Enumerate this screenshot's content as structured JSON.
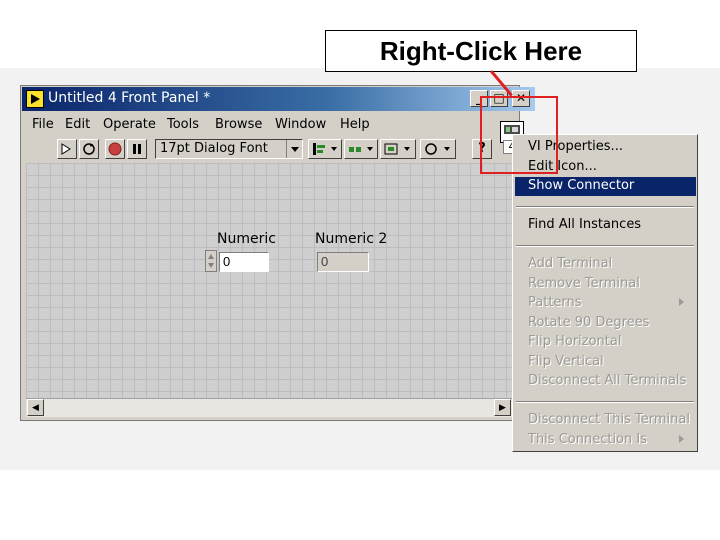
{
  "callout": {
    "text": "Right-Click Here"
  },
  "window": {
    "title": "Untitled 4 Front Panel *",
    "controls": {
      "minimize": "_",
      "maximize": "□",
      "close": "✕"
    }
  },
  "menubar": {
    "items": [
      {
        "label": "File"
      },
      {
        "label": "Edit"
      },
      {
        "label": "Operate"
      },
      {
        "label": "Tools"
      },
      {
        "label": "Browse"
      },
      {
        "label": "Window"
      },
      {
        "label": "Help"
      }
    ]
  },
  "toolbar": {
    "font_selector": "17pt Dialog Font",
    "help_icon": "?",
    "connector_badge": "4"
  },
  "panel": {
    "numeric1": {
      "label": "Numeric",
      "value": "0"
    },
    "numeric2": {
      "label": "Numeric 2",
      "value": "0"
    }
  },
  "context_menu": {
    "items": [
      {
        "label": "VI Properties...",
        "enabled": true
      },
      {
        "label": "Edit Icon...",
        "enabled": true
      },
      {
        "label": "Show Connector",
        "enabled": true,
        "selected": true
      },
      {
        "label": "Find All Instances",
        "enabled": true
      },
      {
        "label": "Add Terminal",
        "enabled": false
      },
      {
        "label": "Remove Terminal",
        "enabled": false
      },
      {
        "label": "Patterns",
        "enabled": false,
        "submenu": true
      },
      {
        "label": "Rotate 90 Degrees",
        "enabled": false
      },
      {
        "label": "Flip Horizontal",
        "enabled": false
      },
      {
        "label": "Flip Vertical",
        "enabled": false
      },
      {
        "label": "Disconnect All Terminals",
        "enabled": false
      },
      {
        "label": "Disconnect This Terminal",
        "enabled": false
      },
      {
        "label": "This Connection Is",
        "enabled": false,
        "submenu": true
      }
    ]
  },
  "colors": {
    "title_bar": "#0a246a",
    "selection": "#0a246a",
    "highlight": "#e02020"
  }
}
